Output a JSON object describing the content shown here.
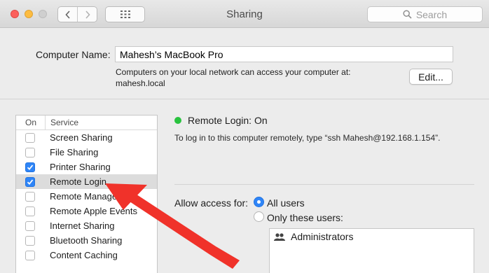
{
  "window": {
    "title": "Sharing"
  },
  "toolbar": {
    "back_icon": "chevron-left-icon",
    "forward_icon": "chevron-right-icon",
    "grid_icon": "grid-icon",
    "search_placeholder": "Search"
  },
  "computer": {
    "label": "Computer Name:",
    "value": "Mahesh’s MacBook Pro",
    "info_line1": "Computers on your local network can access your computer at:",
    "info_line2": "mahesh.local",
    "edit_label": "Edit..."
  },
  "services": {
    "col_on": "On",
    "col_service": "Service",
    "items": [
      {
        "label": "Screen Sharing",
        "checked": false,
        "selected": false
      },
      {
        "label": "File Sharing",
        "checked": false,
        "selected": false
      },
      {
        "label": "Printer Sharing",
        "checked": true,
        "selected": false
      },
      {
        "label": "Remote Login",
        "checked": true,
        "selected": true
      },
      {
        "label": "Remote Management",
        "checked": false,
        "selected": false
      },
      {
        "label": "Remote Apple Events",
        "checked": false,
        "selected": false
      },
      {
        "label": "Internet Sharing",
        "checked": false,
        "selected": false
      },
      {
        "label": "Bluetooth Sharing",
        "checked": false,
        "selected": false
      },
      {
        "label": "Content Caching",
        "checked": false,
        "selected": false
      }
    ]
  },
  "detail": {
    "status_title": "Remote Login: On",
    "status_color": "#29c33f",
    "description": "To log in to this computer remotely, type “ssh Mahesh@192.168.1.154”.",
    "access_label": "Allow access for:",
    "option_all": "All users",
    "option_only": "Only these users:",
    "selected_option": "all",
    "users": [
      {
        "label": "Administrators",
        "icon": "group-icon"
      }
    ]
  },
  "annotation": {
    "arrow_color": "#f0322a"
  }
}
